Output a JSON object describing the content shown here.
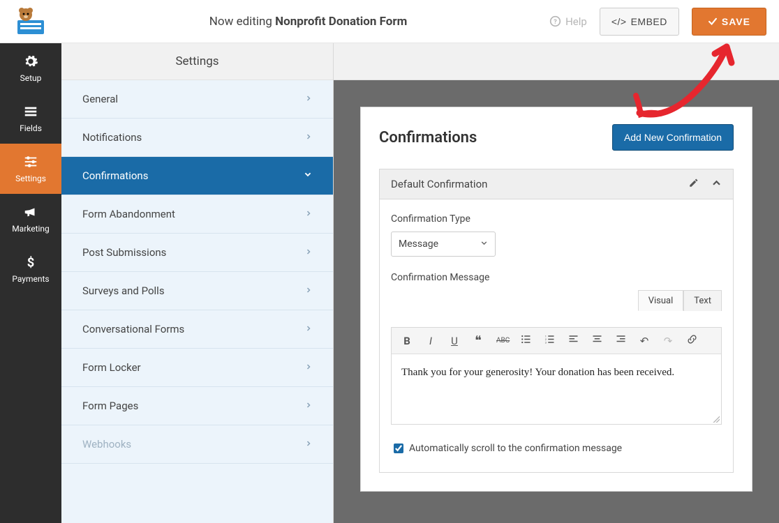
{
  "header": {
    "edit_prefix": "Now editing ",
    "form_name": "Nonprofit Donation Form",
    "help": "Help",
    "embed": "EMBED",
    "save": "SAVE"
  },
  "leftnav": [
    {
      "key": "setup",
      "label": "Setup"
    },
    {
      "key": "fields",
      "label": "Fields"
    },
    {
      "key": "settings",
      "label": "Settings"
    },
    {
      "key": "marketing",
      "label": "Marketing"
    },
    {
      "key": "payments",
      "label": "Payments"
    }
  ],
  "settings_panel_title": "Settings",
  "settings_items": [
    {
      "label": "General",
      "expand": "right"
    },
    {
      "label": "Notifications",
      "expand": "right"
    },
    {
      "label": "Confirmations",
      "expand": "down",
      "active": true
    },
    {
      "label": "Form Abandonment",
      "expand": "right"
    },
    {
      "label": "Post Submissions",
      "expand": "right"
    },
    {
      "label": "Surveys and Polls",
      "expand": "right"
    },
    {
      "label": "Conversational Forms",
      "expand": "right"
    },
    {
      "label": "Form Locker",
      "expand": "right"
    },
    {
      "label": "Form Pages",
      "expand": "right"
    },
    {
      "label": "Webhooks",
      "expand": "right",
      "disabled": true
    }
  ],
  "confirmations": {
    "title": "Confirmations",
    "add_new": "Add New Confirmation",
    "item_title": "Default Confirmation",
    "type_label": "Confirmation Type",
    "type_value": "Message",
    "message_label": "Confirmation Message",
    "message_value": "Thank you for your generosity! Your donation has been received.",
    "editor_tabs": {
      "visual": "Visual",
      "text": "Text"
    },
    "auto_scroll_label": "Automatically scroll to the confirmation message",
    "auto_scroll_checked": true
  }
}
